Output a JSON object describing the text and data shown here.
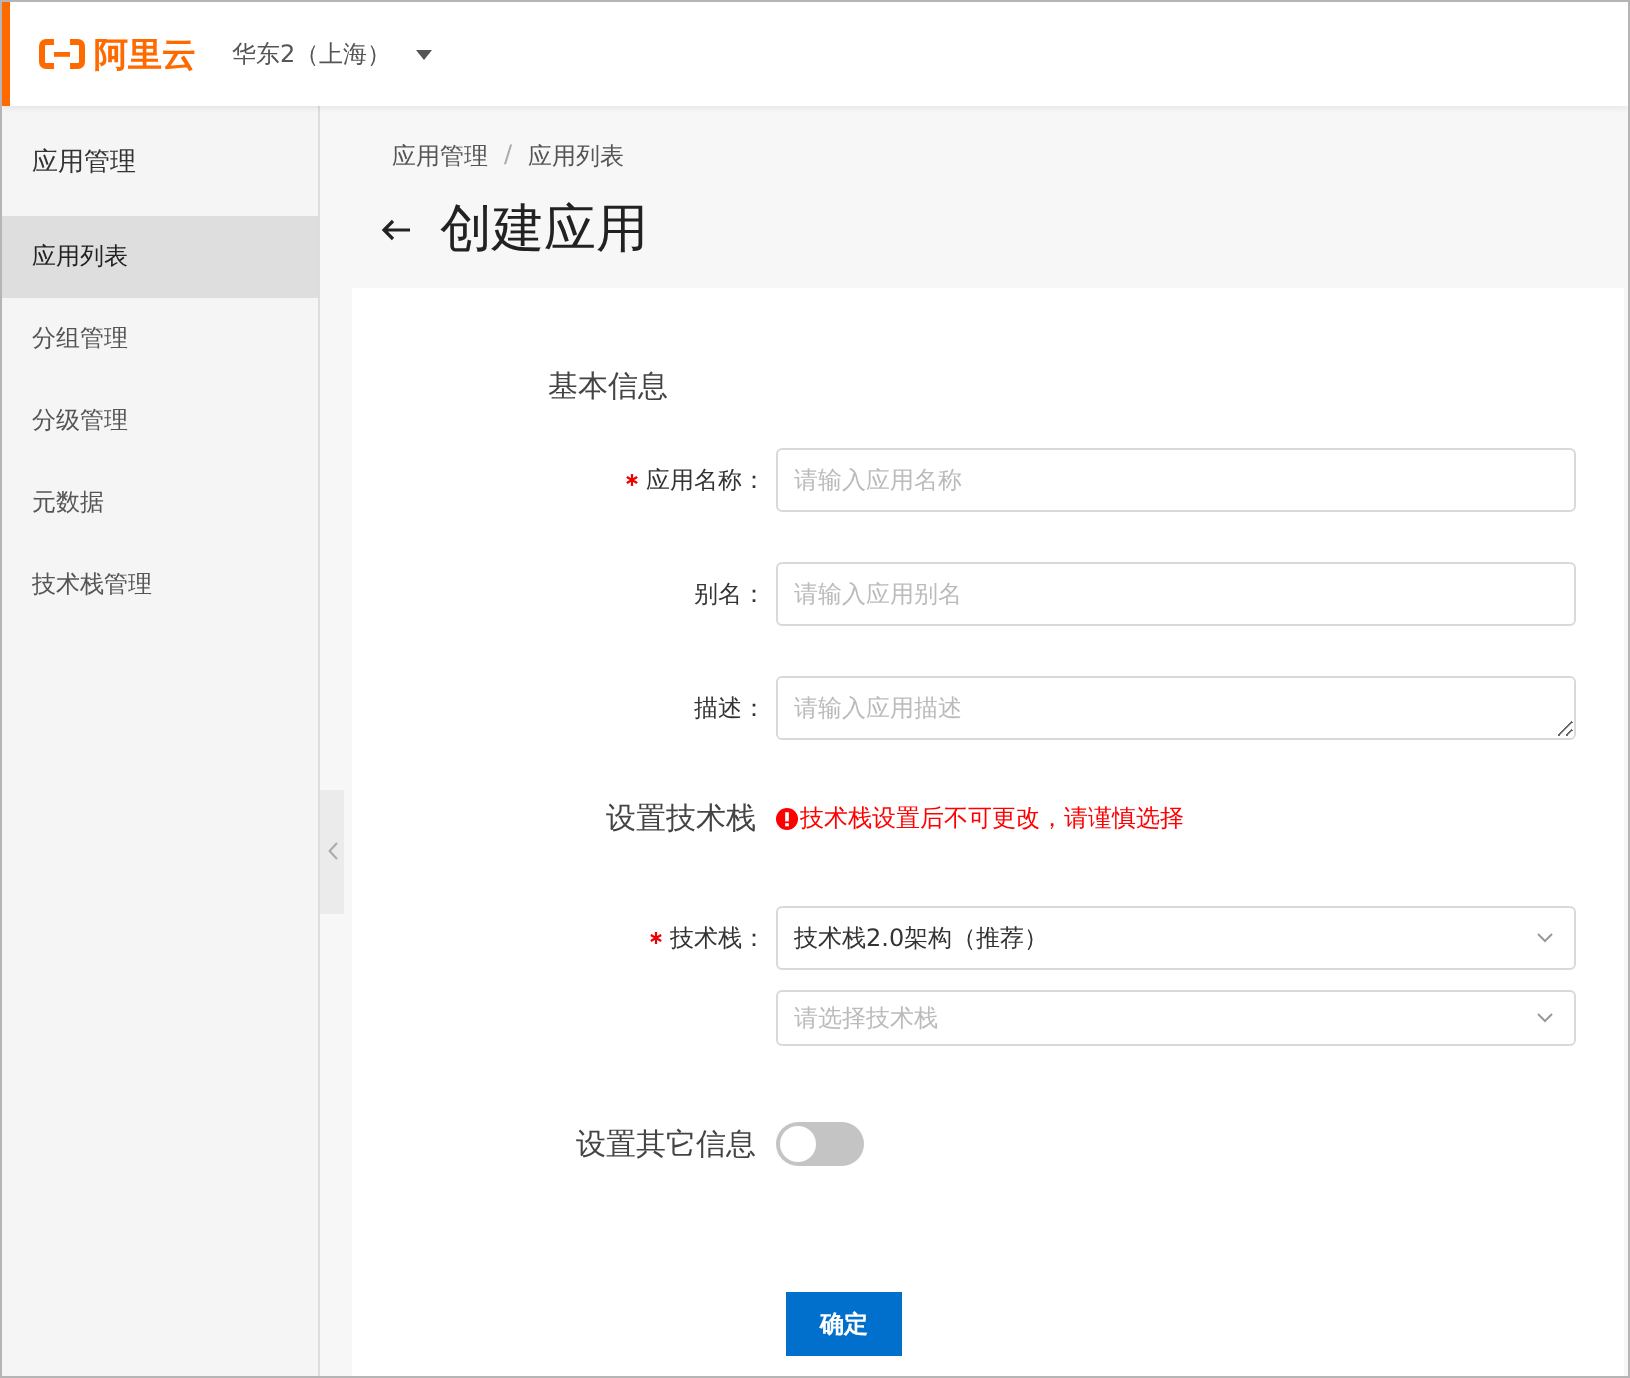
{
  "header": {
    "logo_text": "阿里云",
    "region": "华东2（上海）"
  },
  "sidebar": {
    "title": "应用管理",
    "items": [
      {
        "label": "应用列表",
        "selected": true
      },
      {
        "label": "分组管理",
        "selected": false
      },
      {
        "label": "分级管理",
        "selected": false
      },
      {
        "label": "元数据",
        "selected": false
      },
      {
        "label": "技术栈管理",
        "selected": false
      }
    ]
  },
  "breadcrumb": {
    "separator": "/",
    "items": [
      "应用管理",
      "应用列表"
    ]
  },
  "page_title": "创建应用",
  "form": {
    "sections": [
      {
        "title": "基本信息",
        "fields": [
          {
            "kind": "input",
            "label": "应用名称：",
            "required": true,
            "placeholder": "请输入应用名称"
          },
          {
            "kind": "input",
            "label": "别名：",
            "required": false,
            "placeholder": "请输入应用别名"
          },
          {
            "kind": "textarea",
            "label": "描述：",
            "required": false,
            "placeholder": "请输入应用描述"
          }
        ]
      },
      {
        "title": "设置技术栈",
        "note": "技术栈设置后不可更改，请谨慎选择",
        "fields": [
          {
            "kind": "select",
            "label": "技术栈：",
            "required": true,
            "value": "技术栈2.0架构（推荐）"
          },
          {
            "kind": "select",
            "required": false,
            "placeholder": "请选择技术栈"
          }
        ]
      }
    ],
    "toggle": {
      "label": "设置其它信息",
      "on": false
    },
    "submit": "确定"
  }
}
